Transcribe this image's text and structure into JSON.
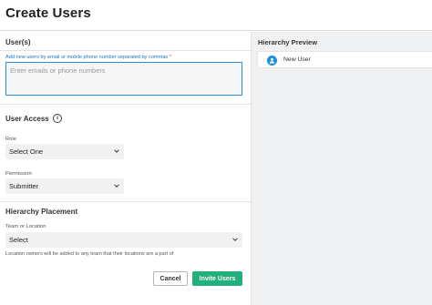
{
  "header": {
    "title": "Create Users"
  },
  "users_section": {
    "title": "User(s)",
    "hint": "Add new users by email or mobile phone number separated by commas",
    "required_mark": "*",
    "input_placeholder": "Enter emails or phone numbers",
    "input_value": ""
  },
  "access_section": {
    "title": "User Access",
    "info_icon": "info-icon",
    "role_label": "Role",
    "role_value": "Select One",
    "permission_label": "Permission",
    "permission_value": "Submitter"
  },
  "hierarchy_section": {
    "title": "Hierarchy Placement",
    "team_label": "Team or Location",
    "team_value": "Select",
    "note": "Location owners will be added to any team that their locations are a part of"
  },
  "actions": {
    "cancel_label": "Cancel",
    "invite_label": "Invite Users"
  },
  "preview": {
    "title": "Hierarchy Preview",
    "user_label": "New User",
    "user_icon": "user-avatar-icon"
  },
  "colors": {
    "accent_blue": "#2a8fd6",
    "primary_green": "#23b07d",
    "required_red": "#d32f2f",
    "panel_gray": "#f0f1f3"
  }
}
